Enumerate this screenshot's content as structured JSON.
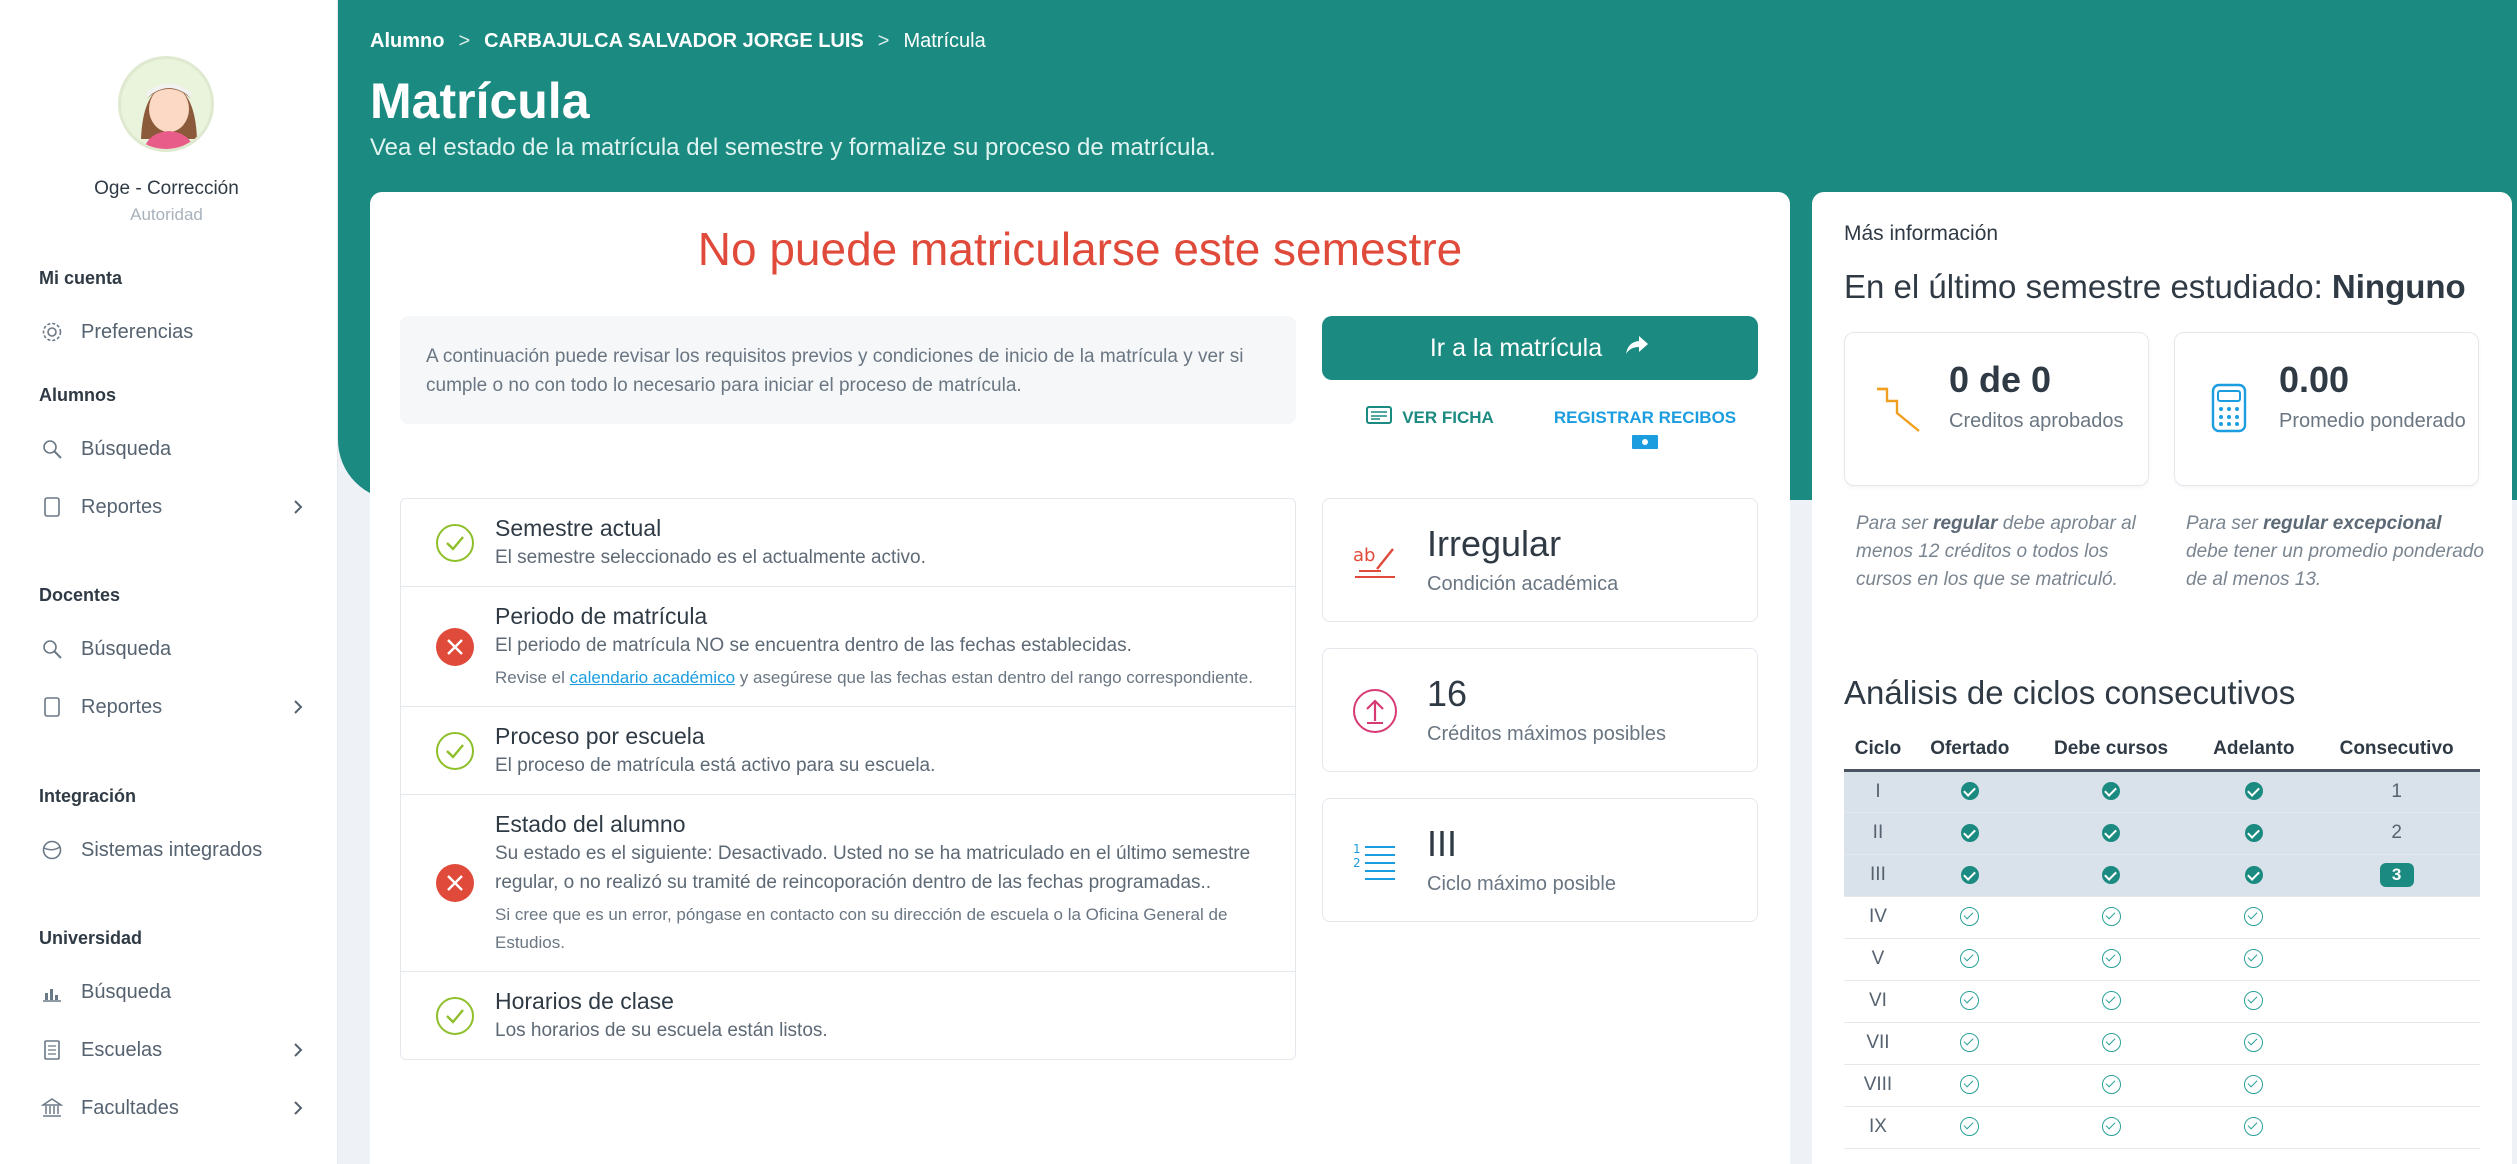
{
  "colors": {
    "primary": "#1b8a80",
    "error": "#e04a3a",
    "success": "#8fbf2b",
    "link": "#1b9de0"
  },
  "sidebar": {
    "user_name": "Oge - Corrección",
    "user_role": "Autoridad",
    "sections": [
      {
        "title": "Mi cuenta",
        "items": [
          {
            "label": "Preferencias",
            "icon": "gear-icon"
          }
        ]
      },
      {
        "title": "Alumnos",
        "items": [
          {
            "label": "Búsqueda",
            "icon": "search-icon"
          },
          {
            "label": "Reportes",
            "icon": "document-icon"
          }
        ]
      },
      {
        "title": "Docentes",
        "items": [
          {
            "label": "Búsqueda",
            "icon": "search-icon"
          },
          {
            "label": "Reportes",
            "icon": "document-icon"
          }
        ]
      },
      {
        "title": "Integración",
        "items": [
          {
            "label": "Sistemas integrados",
            "icon": "globe-icon"
          }
        ]
      },
      {
        "title": "Universidad",
        "items": [
          {
            "label": "Búsqueda",
            "icon": "chart-icon"
          },
          {
            "label": "Escuelas",
            "icon": "building-icon"
          },
          {
            "label": "Facultades",
            "icon": "bank-icon"
          }
        ]
      }
    ]
  },
  "header": {
    "breadcrumb": [
      "Alumno",
      "CARBAJULCA SALVADOR JORGE LUIS",
      "Matrícula"
    ],
    "title": "Matrícula",
    "subtitle": "Vea el estado de la matrícula del semestre y formalize su proceso de matrícula."
  },
  "main": {
    "alert": "No puede matricularse este semestre",
    "intro": "A continuación puede revisar los requisitos previos y condiciones de inicio de la matrícula y ver si cumple o no con todo lo necesario para iniciar el proceso de matrícula.",
    "enroll_button": "Ir a la matrícula",
    "ver_ficha": "VER FICHA",
    "registrar_recibos": "REGISTRAR RECIBOS",
    "checks": [
      {
        "status": "ok",
        "title": "Semestre actual",
        "desc": "El semestre seleccionado es el actualmente activo."
      },
      {
        "status": "error",
        "title": "Periodo de matrícula",
        "desc": "El periodo de matrícula NO se encuentra dentro de las fechas establecidas.",
        "note_pre": "Revise el ",
        "note_link": "calendario académico",
        "note_post": " y asegúrese que las fechas estan dentro del rango correspondiente."
      },
      {
        "status": "ok",
        "title": "Proceso por escuela",
        "desc": "El proceso de matrícula está activo para su escuela."
      },
      {
        "status": "error",
        "title": "Estado del alumno",
        "desc": "Su estado es el siguiente: Desactivado. Usted no se ha matriculado en el último semestre regular, o no realizó su tramité de reincoporación dentro de las fechas programadas..",
        "note": "Si cree que es un error, póngase en contacto con su dirección de escuela o la Oficina General de Estudios."
      },
      {
        "status": "ok",
        "title": "Horarios de clase",
        "desc": "Los horarios de su escuela están listos."
      }
    ],
    "stats": [
      {
        "value": "Irregular",
        "label": "Condición académica",
        "icon": "spellcheck-icon"
      },
      {
        "value": "16",
        "label": "Créditos máximos posibles",
        "icon": "arrow-up-circle-icon"
      },
      {
        "value": "III",
        "label": "Ciclo máximo posible",
        "icon": "numbered-list-icon"
      }
    ]
  },
  "side": {
    "mas_info": "Más información",
    "ultimo_label": "En el último semestre estudiado: ",
    "ultimo_value": "Ninguno",
    "creditos_value": "0 de 0",
    "creditos_label": "Creditos aprobados",
    "promedio_value": "0.00",
    "promedio_label": "Promedio ponderado",
    "note_regular_pre": "Para ser ",
    "note_regular_b": "regular",
    "note_regular_post": " debe aprobar al menos 12 créditos o todos los cursos en los que se matriculó.",
    "note_exc_pre": "Para ser ",
    "note_exc_b": "regular excepcional",
    "note_exc_post": " debe tener un promedio ponderado de al menos 13.",
    "analisis_title": "Análisis de ciclos consecutivos",
    "table_headers": [
      "Ciclo",
      "Ofertado",
      "Debe cursos",
      "Adelanto",
      "Consecutivo"
    ],
    "rows": [
      {
        "ciclo": "I",
        "consecutivo": "1",
        "highlight": true
      },
      {
        "ciclo": "II",
        "consecutivo": "2",
        "highlight": true
      },
      {
        "ciclo": "III",
        "consecutivo": "3",
        "highlight": true,
        "pill": true
      },
      {
        "ciclo": "IV",
        "consecutivo": ""
      },
      {
        "ciclo": "V",
        "consecutivo": ""
      },
      {
        "ciclo": "VI",
        "consecutivo": ""
      },
      {
        "ciclo": "VII",
        "consecutivo": ""
      },
      {
        "ciclo": "VIII",
        "consecutivo": ""
      },
      {
        "ciclo": "IX",
        "consecutivo": ""
      }
    ]
  }
}
